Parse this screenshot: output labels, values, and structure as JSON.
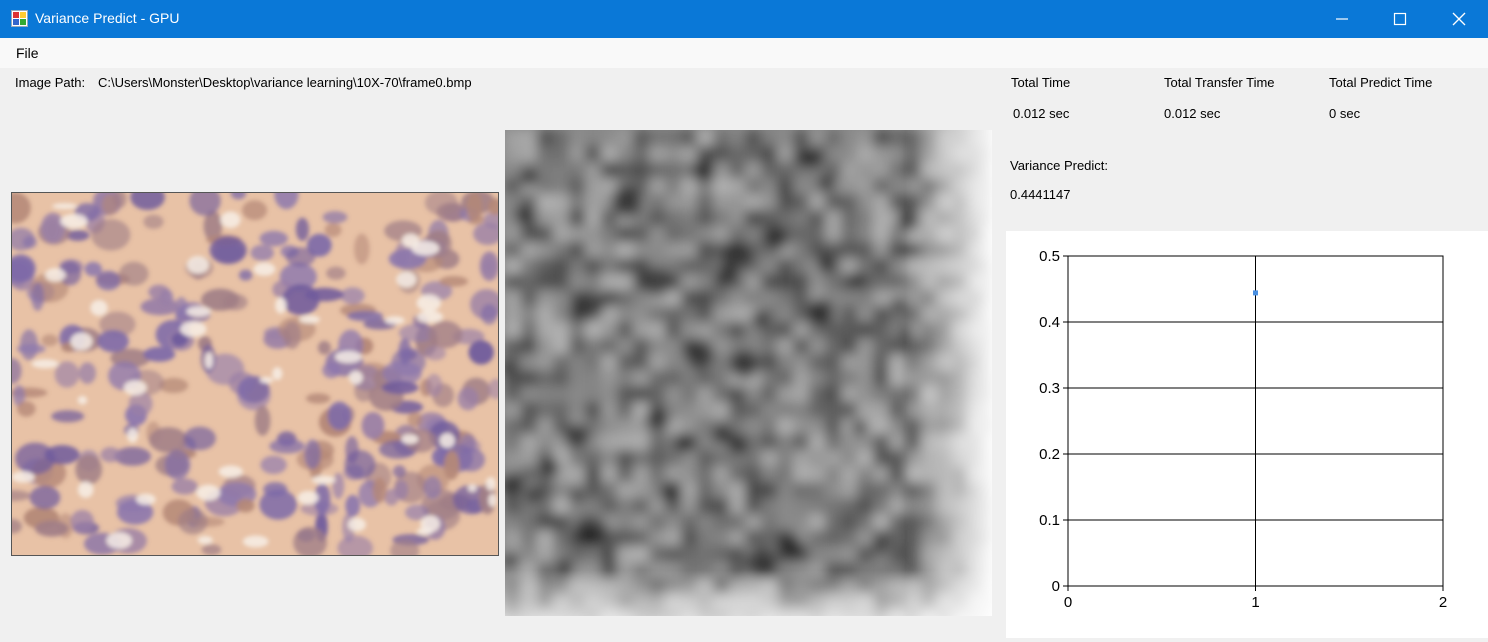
{
  "window": {
    "title": "Variance Predict - GPU",
    "controls": [
      "minimize",
      "maximize",
      "close"
    ]
  },
  "menu": {
    "file_label": "File"
  },
  "image_path": {
    "label": "Image Path:",
    "value": "C:\\Users\\Monster\\Desktop\\variance learning\\10X-70\\frame0.bmp"
  },
  "stats": {
    "total_time_label": "Total Time",
    "total_time_value": "0.012 sec",
    "total_transfer_label": "Total Transfer Time",
    "total_transfer_value": "0.012 sec",
    "total_predict_label": "Total Predict Time",
    "total_predict_value": "0 sec",
    "variance_label": "Variance Predict:",
    "variance_value": "0.4441147"
  },
  "images": {
    "input_image": "microscopy-tissue-image",
    "feature_map": "grayscale-variance-map"
  },
  "chart_data": {
    "type": "scatter",
    "series": [
      {
        "x": [
          1
        ],
        "y": [
          0.4441147
        ],
        "color": "#4a90e2"
      }
    ],
    "xlim": [
      0,
      2
    ],
    "ylim": [
      0,
      0.5
    ],
    "x_ticks": [
      "0",
      "1",
      "2"
    ],
    "y_ticks": [
      "0",
      "0.1",
      "0.2",
      "0.3",
      "0.4",
      "0.5"
    ],
    "grid": true
  }
}
